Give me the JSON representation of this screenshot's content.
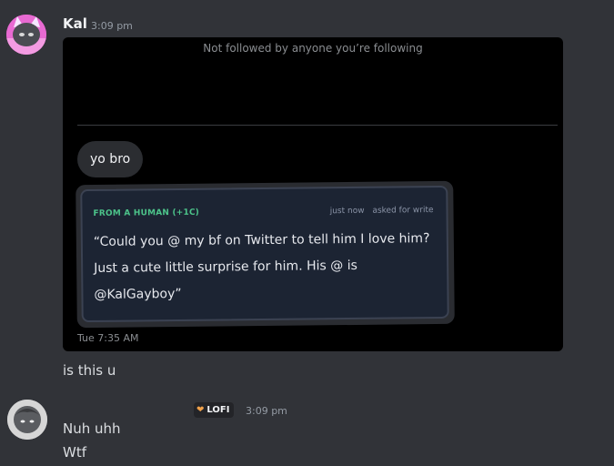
{
  "messages": [
    {
      "author": "Kal",
      "time": "3:09 pm",
      "embed": {
        "header": "Not followed by anyone you’re following",
        "bubble": "yo bro",
        "card": {
          "source": "FROM A HUMAN (+1C)",
          "meta_time": "just now",
          "meta_action": "asked for write",
          "quote": "“Could you @ my bf on Twitter to tell him I love him? Just a cute little surprise for him. His @ is @KalGayboy”"
        },
        "footer_time": "Tue 7:35 AM"
      },
      "text": "is this u"
    },
    {
      "badge_icon": "heart-icon",
      "badge_label": "LOFI",
      "time": "3:09 pm",
      "lines": [
        "Nuh uhh",
        "Wtf"
      ]
    }
  ],
  "colors": {
    "background": "#313338",
    "embed_bg": "#000000",
    "card_bg": "#1c2433",
    "card_source": "#4cc38a",
    "badge_heart": "#f0a14a"
  }
}
